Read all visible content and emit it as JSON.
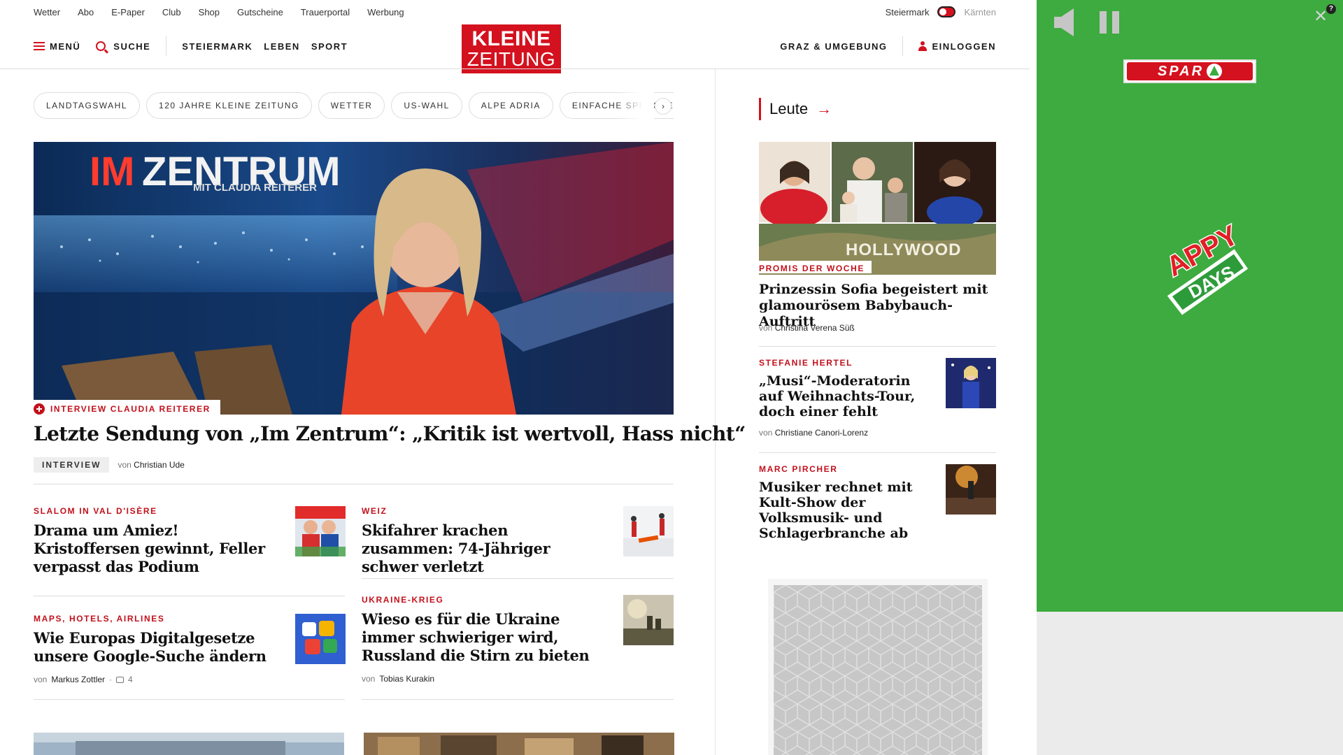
{
  "utility": {
    "links": [
      "Wetter",
      "Abo",
      "E-Paper",
      "Club",
      "Shop",
      "Gutscheine",
      "Trauerportal",
      "Werbung"
    ],
    "region_left": "Steiermark",
    "region_right": "Kärnten"
  },
  "nav": {
    "menu": "MENÜ",
    "search": "SUCHE",
    "sections": [
      "STEIERMARK",
      "LEBEN",
      "SPORT"
    ],
    "local": "GRAZ & UMGEBUNG",
    "login": "EINLOGGEN"
  },
  "logo": {
    "line1": "KLEINE",
    "line2": "ZEITUNG"
  },
  "tags": [
    "LANDTAGSWAHL",
    "120 JAHRE KLEINE ZEITUNG",
    "WETTER",
    "US-WAHL",
    "ALPE ADRIA",
    "EINFACHE SPRACHE"
  ],
  "hero": {
    "image_text": {
      "im": "IM",
      "zentrum": "ZENTRUM",
      "sub": "MIT CLAUDIA REITERER"
    },
    "kicker": "INTERVIEW CLAUDIA REITERER",
    "title": "Letzte Sendung von „Im Zentrum“: „Kritik ist wertvoll, Hass nicht“",
    "badge": "INTERVIEW",
    "by_prefix": "von",
    "author": "Christian Ude"
  },
  "teasers": [
    {
      "kicker": "SLALOM IN VAL D'ISÈRE",
      "title": "Drama um Amiez! Kristoffersen gewinnt, Feller verpasst das Podium"
    },
    {
      "kicker": "WEIZ",
      "title": "Skifahrer krachen zusammen: 74-Jähriger schwer verletzt"
    },
    {
      "kicker": "MAPS, HOTELS, AIRLINES",
      "title": "Wie Europas Digitalgesetze unsere Google-Suche ändern",
      "by_prefix": "von",
      "author": "Markus Zottler",
      "comments": "4"
    },
    {
      "kicker": "UKRAINE-KRIEG",
      "title": "Wieso es für die Ukraine immer schwieriger wird, Russland die Stirn zu bieten",
      "by_prefix": "von",
      "author": "Tobias Kurakin"
    }
  ],
  "sidebar": {
    "section": "Leute",
    "hero_image_text": "HOLLYWOOD",
    "hero_kicker": "PROMIS DER WOCHE",
    "hero_title": "Prinzessin Sofia begeistert mit glamourösem Babybauch-Auftritt",
    "hero_by_prefix": "von",
    "hero_author": "Christina Verena Süß",
    "items": [
      {
        "kicker": "STEFANIE HERTEL",
        "title": "„Musi“-Moderatorin auf Weihnachts-Tour, doch einer fehlt",
        "by_prefix": "von",
        "author": "Christiane Canori-Lorenz"
      },
      {
        "kicker": "MARC PIRCHER",
        "title": "Musiker rechnet mit Kult-Show der Volksmusik- und Schlagerbranche ab"
      }
    ]
  },
  "promo": {
    "brand": "SPAR",
    "campaign_line1": "APPY",
    "campaign_line2": "DAYS",
    "help": "?"
  },
  "colors": {
    "brand_red": "#d4111e",
    "kicker_red": "#c2101b",
    "promo_green": "#3dab3f"
  }
}
